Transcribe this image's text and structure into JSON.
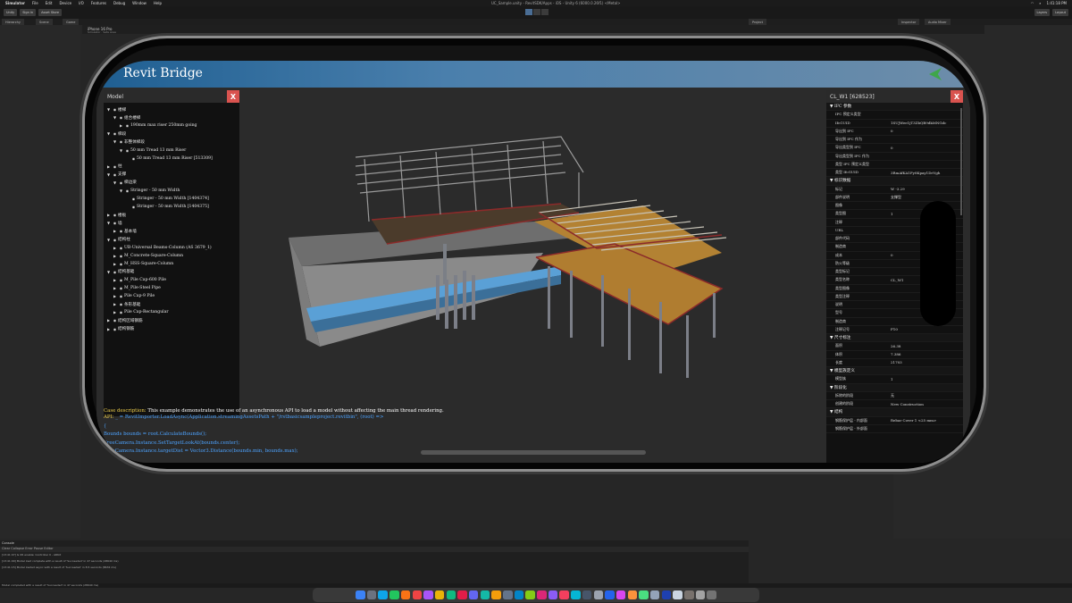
{
  "menubar": {
    "app": "Simulator",
    "items": [
      "File",
      "Edit",
      "Device",
      "I/O",
      "Features",
      "Debug",
      "Window",
      "Help"
    ],
    "title": "UC_Sample.unity - RevitSDK/Apps - iOS - Unity 6 (6000.0.26f1) <Metal>",
    "clock": "1:41:18 PM"
  },
  "toolbar": {
    "left_buttons": [
      "Unity",
      "Sign in",
      "Asset Store"
    ],
    "right_buttons": [
      "Layers",
      "Layout"
    ]
  },
  "tabs": {
    "hierarchy": "Hierarchy",
    "scene": "Scene",
    "game": "Game",
    "project": "Project",
    "inspector": "Inspector",
    "audio": "Audio Mixer",
    "simulator_title": "iPhone 16 Pro",
    "simulator_sub": "Simulator · Safe Area"
  },
  "app": {
    "title": "Revit Bridge",
    "description_label": "Case description:",
    "description_text": "This example demonstrates the use of an asynchronous API to load a model without affecting the main thread rendering.",
    "code_label": "API:",
    "code_lines": [
      "_ = RevitImporter.LoadAsync(Application.streamingAssetsPath + \"/rstbasicsampleproject.revitbin\", (root) =>",
      "{",
      "Bounds bounds = root.CalculateBounds();",
      "FreeCamera.Instance.SetTargetLookAt(bounds.center);",
      "FreeCamera.Instance.targetDist = Vector3.Distance(bounds.min, bounds.max);"
    ]
  },
  "model_panel": {
    "title": "Model",
    "close": "X",
    "tree": [
      {
        "indent": 0,
        "label": "楼梯"
      },
      {
        "indent": 1,
        "label": "组合楼梯"
      },
      {
        "indent": 2,
        "label": "190mm max riser 250mm going"
      },
      {
        "indent": 0,
        "label": "梯段"
      },
      {
        "indent": 1,
        "label": "非整体梯段"
      },
      {
        "indent": 2,
        "label": "50 mm Tread 13 mm Riser"
      },
      {
        "indent": 3,
        "label": "50 mm Tread 13 mm Riser [513309]"
      },
      {
        "indent": 0,
        "label": "柱"
      },
      {
        "indent": 0,
        "label": "支撑"
      },
      {
        "indent": 1,
        "label": "梯边梁"
      },
      {
        "indent": 2,
        "label": "Stringer - 50 mm Width"
      },
      {
        "indent": 3,
        "label": "Stringer - 50 mm Width [1404374]"
      },
      {
        "indent": 3,
        "label": "Stringer - 50 mm Width [1404375]"
      },
      {
        "indent": 0,
        "label": "楼板"
      },
      {
        "indent": 0,
        "label": "墙"
      },
      {
        "indent": 1,
        "label": "基本墙"
      },
      {
        "indent": 0,
        "label": "结构柱"
      },
      {
        "indent": 1,
        "label": "UB-Universal Beams-Column (AS 3679_1)"
      },
      {
        "indent": 1,
        "label": "M_Concrete-Square-Column"
      },
      {
        "indent": 1,
        "label": "M_HSS-Square-Column"
      },
      {
        "indent": 0,
        "label": "结构基础"
      },
      {
        "indent": 1,
        "label": "M_Pile Cap-600 Pile"
      },
      {
        "indent": 1,
        "label": "M_Pile-Steel Pipe"
      },
      {
        "indent": 1,
        "label": "Pile Cap-9 Pile"
      },
      {
        "indent": 1,
        "label": "条形基础"
      },
      {
        "indent": 1,
        "label": "Pile Cap-Rectangular"
      },
      {
        "indent": 0,
        "label": "结构区域钢筋"
      },
      {
        "indent": 0,
        "label": "结构钢筋"
      }
    ]
  },
  "props_panel": {
    "title": "CL_W1 [628523]",
    "close": "X",
    "rows": [
      {
        "section": true,
        "key": "IFC 参数"
      },
      {
        "key": "IFC 预定义类型",
        "value": ""
      },
      {
        "key": "IfcGUID",
        "value": "1SUJWee1jT3ZbQB9dkMNGdc"
      },
      {
        "key": "导出到 IFC",
        "value": "0"
      },
      {
        "key": "导出到 IFC 作为",
        "value": ""
      },
      {
        "key": "导出类型到 IFC",
        "value": "0"
      },
      {
        "key": "导出类型到 IFC 作为",
        "value": ""
      },
      {
        "key": "类型 IFC 预定义类型",
        "value": ""
      },
      {
        "key": "类型 IfcGUID",
        "value": "3RmAfKA1Fy8Kpay1DrVgh"
      },
      {
        "section": true,
        "key": "标识数据"
      },
      {
        "key": "标记",
        "value": "W -3.29"
      },
      {
        "key": "部件说明",
        "value": "支撑型"
      },
      {
        "key": "图像",
        "value": ""
      },
      {
        "key": "类型图",
        "value": "1"
      },
      {
        "key": "注释",
        "value": ""
      },
      {
        "key": "URL",
        "value": ""
      },
      {
        "key": "部件代码",
        "value": ""
      },
      {
        "key": "制造商",
        "value": ""
      },
      {
        "key": "成本",
        "value": "0"
      },
      {
        "key": "防火等级",
        "value": ""
      },
      {
        "key": "类型标记",
        "value": ""
      },
      {
        "key": "类型名称",
        "value": "CL_W1"
      },
      {
        "key": "类型图像",
        "value": ""
      },
      {
        "key": "类型注释",
        "value": ""
      },
      {
        "key": "说明",
        "value": ""
      },
      {
        "key": "型号",
        "value": ""
      },
      {
        "key": "制造商",
        "value": ""
      },
      {
        "key": "注释记号",
        "value": "F10"
      },
      {
        "section": true,
        "key": "尺寸标注"
      },
      {
        "key": "面积",
        "value": "26.38"
      },
      {
        "key": "体积",
        "value": "7.386"
      },
      {
        "key": "长度",
        "value": "21703"
      },
      {
        "section": true,
        "key": "模型族定义"
      },
      {
        "key": "模型族",
        "value": "1"
      },
      {
        "section": true,
        "key": "阶段化"
      },
      {
        "key": "拆除的阶段",
        "value": "无"
      },
      {
        "key": "创建的阶段",
        "value": "New Construction"
      },
      {
        "section": true,
        "key": "结构"
      },
      {
        "key": "钢筋保护层 - 内部面",
        "value": "Rebar Cover 1 <25 mm>"
      },
      {
        "key": "钢筋保护层 - 外部面",
        "value": ""
      }
    ]
  },
  "console": {
    "tab": "Console",
    "toolbar": "Clear   Collapse   Error Pause   Editor",
    "lines": [
      "[13:41:07] Is XR enable: Controller 0 - ARKit",
      "[13:41:09] Model load complete with a result of 'Succeeded' in 47 seconds (28640 ms)",
      "[13:41:15] Model loaded async with a result of 'Succeeded' in 8.5 seconds (8632 ms)"
    ],
    "status": "Model completed with a result of 'Succeeded' in 47 seconds (28640 ms)"
  },
  "colors": {
    "appbar": "#2f6b9e",
    "close": "#d9534f",
    "beam": "#8b2a2a",
    "deck": "#b38233",
    "wall": "#9a9a9a",
    "blue_strip": "#5aa0d6"
  }
}
